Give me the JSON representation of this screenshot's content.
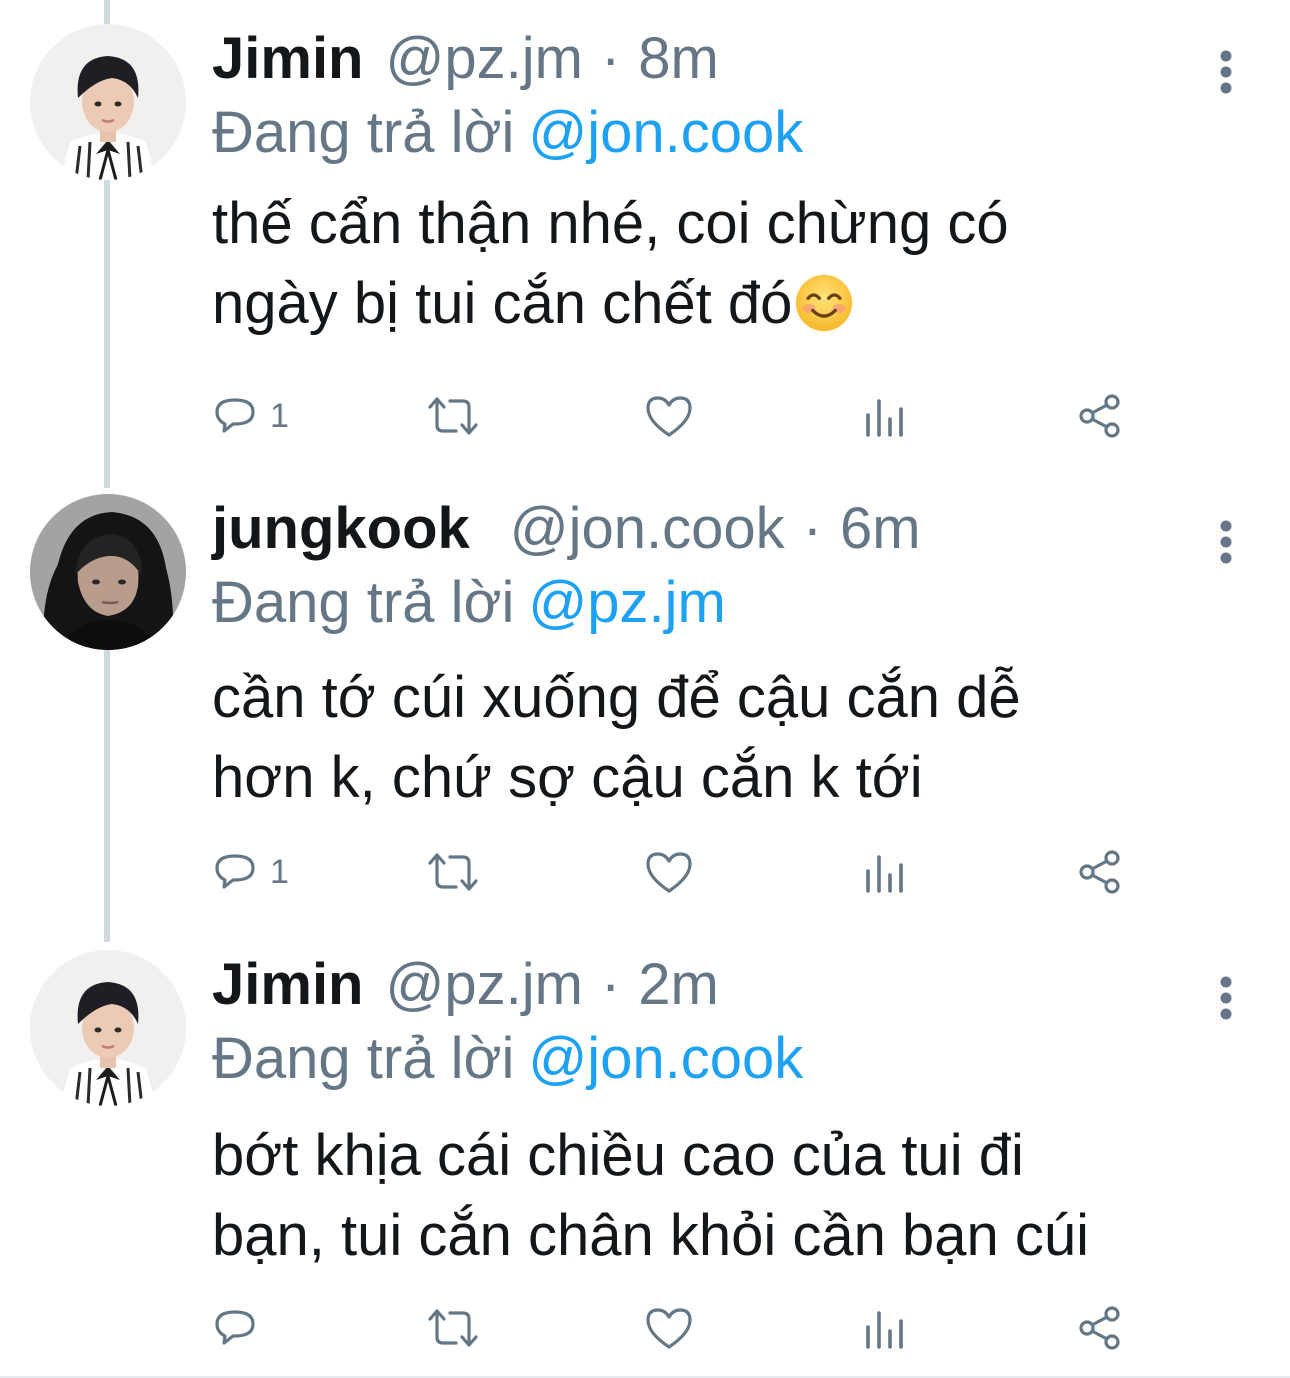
{
  "colors": {
    "text": "#14171a",
    "secondary": "#657786",
    "mention": "#1da1f2",
    "thread_line": "#cfd9de",
    "icon": "#657786"
  },
  "tweets": [
    {
      "name": "Jimin",
      "handle": "@pz.jm",
      "separator": "·",
      "time": "8m",
      "reply_prefix": "Đang trả lời",
      "reply_to": "@jon.cook",
      "text_lines": [
        "thế cẩn thận nhé, coi chừng có",
        "ngày bị tui cắn chết đó"
      ],
      "emoji": "smiling-face-emoji",
      "reply_count": "1",
      "avatar": "jimin-avatar",
      "icons": {
        "more": "more-vertical-icon",
        "reply": "reply-icon",
        "retweet": "retweet-icon",
        "like": "heart-icon",
        "stats": "analytics-icon",
        "share": "share-icon"
      }
    },
    {
      "name": "jungkook",
      "handle": "@jon.cook",
      "separator": "·",
      "time": "6m",
      "reply_prefix": "Đang trả lời",
      "reply_to": "@pz.jm",
      "text_lines": [
        "cần tớ cúi xuống để cậu cắn dễ",
        "hơn k, chứ sợ cậu cắn k tới"
      ],
      "reply_count": "1",
      "avatar": "jungkook-avatar",
      "icons": {
        "more": "more-vertical-icon",
        "reply": "reply-icon",
        "retweet": "retweet-icon",
        "like": "heart-icon",
        "stats": "analytics-icon",
        "share": "share-icon"
      }
    },
    {
      "name": "Jimin",
      "handle": "@pz.jm",
      "separator": "·",
      "time": "2m",
      "reply_prefix": "Đang trả lời",
      "reply_to": "@jon.cook",
      "text_lines": [
        "bớt khịa cái chiều cao của tui đi",
        "bạn, tui cắn chân khỏi cần bạn cúi"
      ],
      "reply_count": "",
      "avatar": "jimin-avatar",
      "icons": {
        "more": "more-vertical-icon",
        "reply": "reply-icon",
        "retweet": "retweet-icon",
        "like": "heart-icon",
        "stats": "analytics-icon",
        "share": "share-icon"
      }
    }
  ]
}
